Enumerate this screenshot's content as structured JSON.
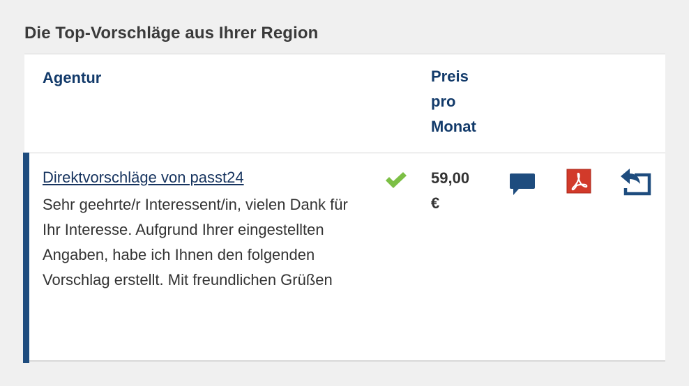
{
  "section": {
    "title": "Die Top-Vorschläge aus Ihrer Region"
  },
  "table": {
    "columns": {
      "agentur": "Agentur",
      "preis_lines": [
        "Preis",
        "pro",
        "Monat"
      ]
    },
    "rows": [
      {
        "link_text": "Direktvorschläge von passt24",
        "description": "Sehr geehrte/r Interessent/in, vielen Dank für Ihr Interesse. Aufgrund Ihrer eingestellten Angaben, habe ich Ihnen den folgenden Vorschlag erstellt. Mit freundlichen Grüßen",
        "price_lines": [
          "59,00",
          "€"
        ],
        "icons": [
          "check-icon",
          "chat-bubble-icon",
          "pdf-icon",
          "reply-icon"
        ]
      }
    ]
  },
  "colors": {
    "accent": "#1e4c7e",
    "heading": "#123a6a",
    "check": "#7cbf45",
    "pdf": "#d23a2a"
  }
}
